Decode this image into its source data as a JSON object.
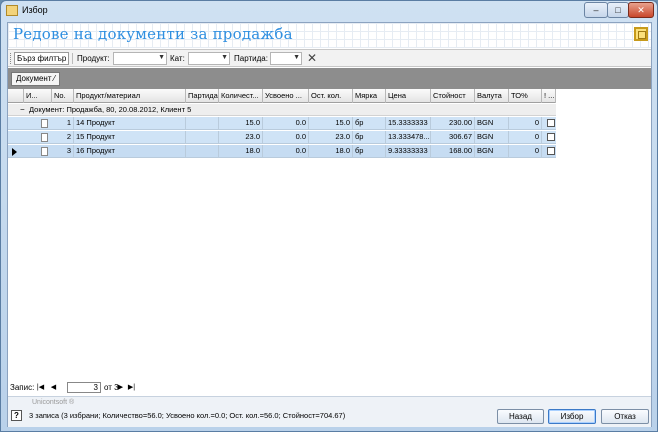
{
  "window": {
    "title": "Избор",
    "min": "–",
    "max": "□",
    "close": "✕"
  },
  "header": {
    "title": "Редове на документи за продажба"
  },
  "filterbar": {
    "quick_filter": "Бърз филтър",
    "product_label": "Продукт:",
    "category_label": "Кат:",
    "batch_label": "Партида:",
    "clear": "✕"
  },
  "groupbar": {
    "chip": "Документ ⁄"
  },
  "columns": [
    "И...",
    "No.",
    "Продукт/материал",
    "Партида",
    "Количест...",
    "Усвоено ...",
    "Ост. кол.",
    "Мярка",
    "Цена",
    "Стойност",
    "Валута",
    "ТО%",
    "! ..."
  ],
  "group_row": {
    "text": "Документ: Продажба, 80, 20.08.2012, Клиент 5",
    "toggle": "−"
  },
  "rows": [
    {
      "no": "1",
      "product": "14 Продукт",
      "batch": "",
      "qty": "15.0",
      "used": "0.0",
      "rest": "15.0",
      "unit": "бр",
      "price": "15.3333333",
      "value": "230.00",
      "currency": "BGN",
      "to": "0"
    },
    {
      "no": "2",
      "product": "15 Продукт",
      "batch": "",
      "qty": "23.0",
      "used": "0.0",
      "rest": "23.0",
      "unit": "бр",
      "price": "13.333478...",
      "value": "306.67",
      "currency": "BGN",
      "to": "0"
    },
    {
      "no": "3",
      "product": "16 Продукт",
      "batch": "",
      "qty": "18.0",
      "used": "0.0",
      "rest": "18.0",
      "unit": "бр",
      "price": "9.33333333",
      "value": "168.00",
      "currency": "BGN",
      "to": "0"
    }
  ],
  "navigator": {
    "label": "Запис:",
    "current": "3",
    "of": "от 3",
    "first": "|◀",
    "prev": "◀",
    "next": "▶",
    "last": "▶|"
  },
  "footer": {
    "brand": "Unicontsoft ®",
    "help": "?",
    "status": "3 записа (3 избрани; Количество=56.0; Усвоено кол.=0.0; Ост. кол.=56.0; Стойност=704.67)",
    "back": "Назад",
    "select": "Избор",
    "cancel": "Отказ"
  }
}
